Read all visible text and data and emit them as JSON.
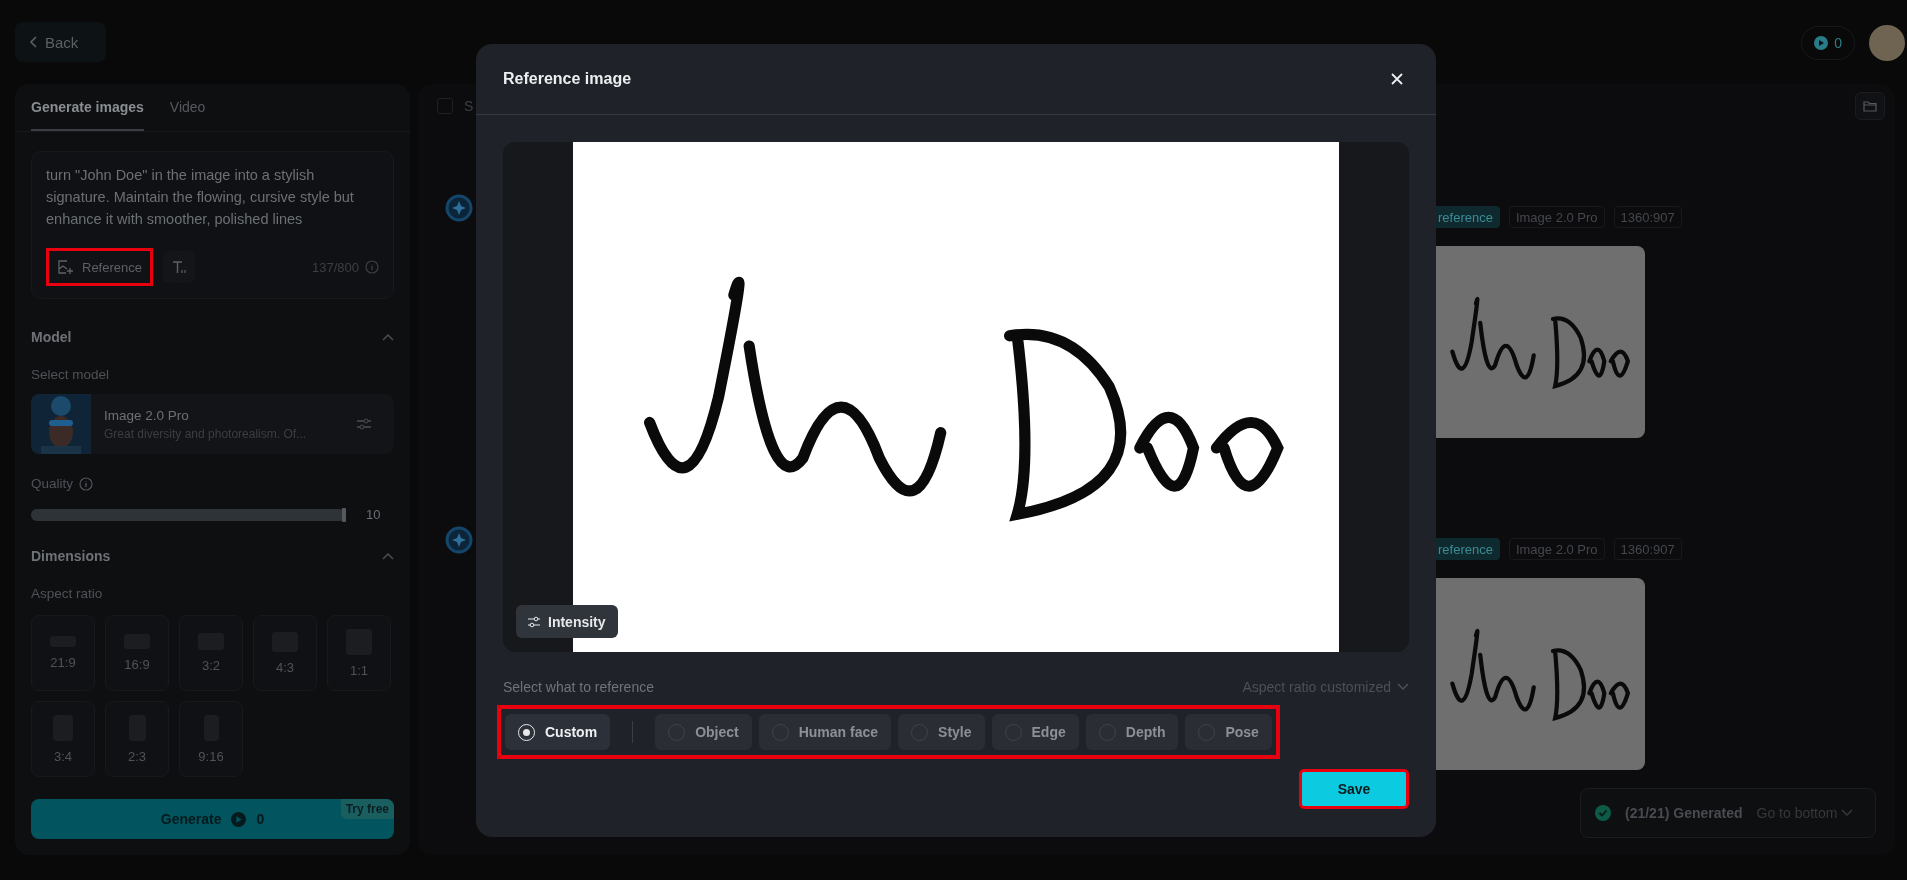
{
  "top_bar": {
    "back": "Back",
    "credits": "0"
  },
  "left_panel": {
    "tabs": [
      {
        "label": "Generate images",
        "selected": true
      },
      {
        "label": "Video",
        "selected": false
      }
    ],
    "prompt": {
      "value": "turn \"John Doe\" in the image into a stylish signature. Maintain the flowing, cursive style but enhance it with smoother, polished lines",
      "reference_button": "Reference",
      "highlighted": true,
      "counter": "137/800"
    },
    "model": {
      "title": "Model",
      "expanded": true,
      "select_label": "Select model",
      "name": "Image 2.0 Pro",
      "description": "Great diversity and photorealism. Of..."
    },
    "quality": {
      "label": "Quality",
      "level": 1,
      "reading": "10"
    },
    "dimensions": {
      "title": "Dimensions",
      "expanded": true,
      "label": "Aspect ratio",
      "ratios": [
        {
          "label": "21:9"
        },
        {
          "label": "16:9"
        },
        {
          "label": "3:2"
        },
        {
          "label": "4:3"
        },
        {
          "label": "1:1"
        },
        {
          "label": "3:4"
        },
        {
          "label": "2:3"
        },
        {
          "label": "9:16"
        }
      ]
    },
    "generate": {
      "label": "Generate",
      "cost": "0",
      "badge": "Try free"
    }
  },
  "main_panel": {
    "show_checkbox": {
      "label": "S",
      "checked": false
    },
    "results": [
      {
        "tags": [
          "reference",
          "Image 2.0 Pro",
          "1360:907"
        ]
      },
      {
        "tags": [
          "reference",
          "Image 2.0 Pro",
          "1360:907"
        ]
      }
    ],
    "status": {
      "text": "(21/21) Generated",
      "link": "Go to bottom"
    }
  },
  "dialog": {
    "title": "Reference image",
    "intensity": "Intensity",
    "section_label": "Select what to reference",
    "aspect": "Aspect ratio customized",
    "options_highlighted": true,
    "options": [
      {
        "label": "Custom",
        "selected": true
      },
      {
        "label": "Object",
        "selected": false
      },
      {
        "label": "Human face",
        "selected": false
      },
      {
        "label": "Style",
        "selected": false
      },
      {
        "label": "Edge",
        "selected": false
      },
      {
        "label": "Depth",
        "selected": false
      },
      {
        "label": "Pose",
        "selected": false
      }
    ],
    "save": "Save",
    "save_highlighted": true
  }
}
